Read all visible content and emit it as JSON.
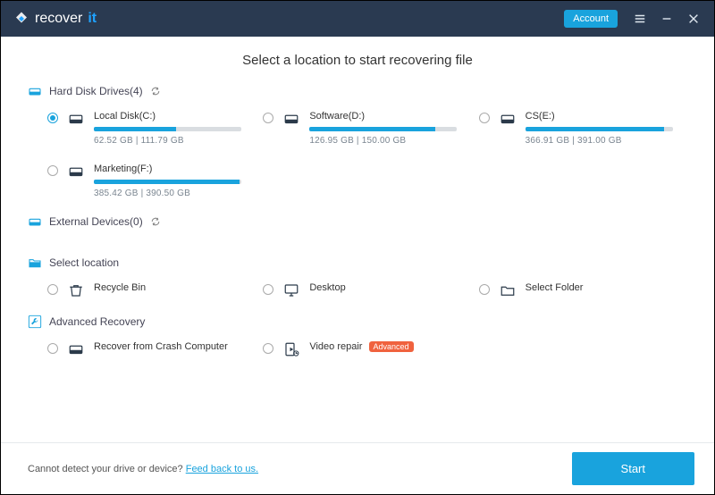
{
  "titlebar": {
    "brand_a": "recover",
    "brand_b": "it",
    "account_label": "Account"
  },
  "heading": "Select a location to start recovering file",
  "sections": {
    "drives_label": "Hard Disk Drives(4)",
    "ext_label": "External Devices(0)",
    "select_label": "Select location",
    "adv_label": "Advanced Recovery"
  },
  "drives": [
    {
      "label": "Local Disk(C:)",
      "used": 62.52,
      "total": 111.79,
      "size_text": "62.52  GB | 111.79  GB",
      "pct": 56,
      "selected": true
    },
    {
      "label": "Software(D:)",
      "used": 126.95,
      "total": 150.0,
      "size_text": "126.95  GB | 150.00  GB",
      "pct": 85,
      "selected": false
    },
    {
      "label": "CS(E:)",
      "used": 366.91,
      "total": 391.0,
      "size_text": "366.91  GB | 391.00  GB",
      "pct": 94,
      "selected": false
    },
    {
      "label": "Marketing(F:)",
      "used": 385.42,
      "total": 390.5,
      "size_text": "385.42  GB | 390.50  GB",
      "pct": 99,
      "selected": false
    }
  ],
  "locations": [
    {
      "label": "Recycle Bin"
    },
    {
      "label": "Desktop"
    },
    {
      "label": "Select Folder"
    }
  ],
  "advanced": [
    {
      "label": "Recover from Crash Computer",
      "badge": null
    },
    {
      "label": "Video repair",
      "badge": "Advanced"
    }
  ],
  "footer": {
    "text": "Cannot detect your drive or device? ",
    "link": "Feed back to us.",
    "start": "Start"
  }
}
